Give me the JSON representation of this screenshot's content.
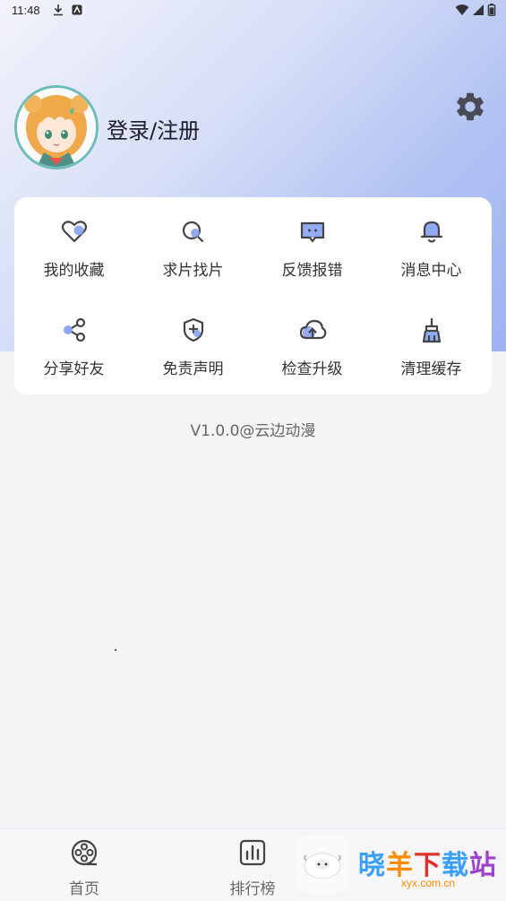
{
  "status_bar": {
    "time": "11:48"
  },
  "profile": {
    "login_label": "登录/注册"
  },
  "menu": {
    "items": [
      {
        "label": "我的收藏",
        "icon": "heart-icon"
      },
      {
        "label": "求片找片",
        "icon": "search-icon"
      },
      {
        "label": "反馈报错",
        "icon": "chat-feedback-icon"
      },
      {
        "label": "消息中心",
        "icon": "bell-icon"
      },
      {
        "label": "分享好友",
        "icon": "share-icon"
      },
      {
        "label": "免责声明",
        "icon": "shield-icon"
      },
      {
        "label": "检查升级",
        "icon": "cloud-upload-icon"
      },
      {
        "label": "清理缓存",
        "icon": "broom-icon"
      }
    ]
  },
  "version_text": "V1.0.0@云边动漫",
  "bottom_nav": {
    "items": [
      {
        "label": "首页",
        "icon": "film-reel-icon"
      },
      {
        "label": "排行榜",
        "icon": "bar-chart-icon"
      }
    ]
  },
  "watermark": {
    "text": "晓羊下载站",
    "sub": "xyx.com.cn"
  },
  "colors": {
    "accent": "#7f9cf0",
    "icon_stroke": "#444444",
    "avatar_border": "#6cbcb8"
  }
}
